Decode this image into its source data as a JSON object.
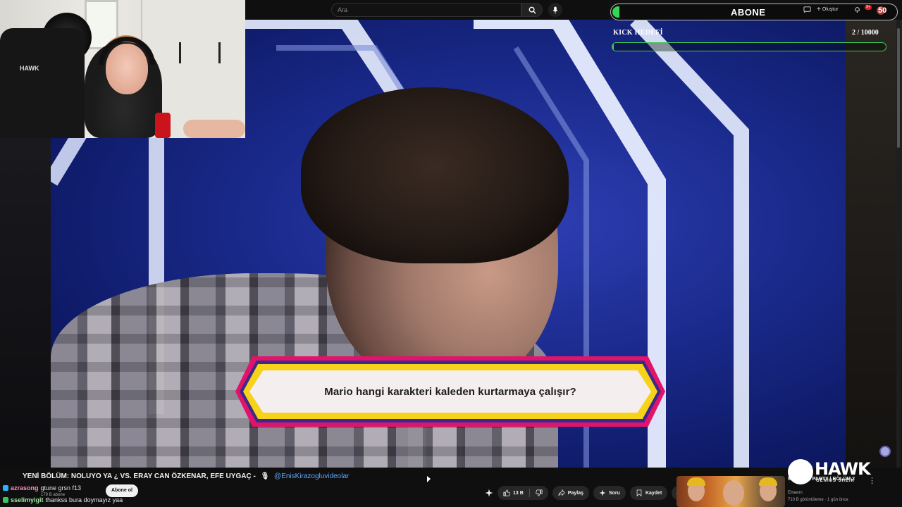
{
  "search": {
    "placeholder": "Ara"
  },
  "header": {
    "create_label": "Oluştur",
    "notifications_badge": "9+"
  },
  "overlay": {
    "abone_label": "ABONE",
    "abone_count": "50",
    "kick_goal_label": "KICK HEDEFİ",
    "kick_goal_count": "2 / 10000",
    "kick_goal_progress": 0.0002,
    "accent_color": "#3ccb57"
  },
  "video": {
    "question": "Mario hangi karakteri kaleden kurtarmaya çalışır?"
  },
  "webcam": {
    "chair_logo": "HAWK"
  },
  "info": {
    "title": "YENİ BÖLÜM: NOLUYO YA ¿ VS. ERAY CAN ÖZKENAR, EFE UYGAÇ -",
    "mention": "@EnisKirazogluvideolar",
    "subscribers": "179 B abone",
    "subscribe_label": "Abone ol"
  },
  "chat": [
    {
      "user": "azrasong",
      "message": "gtune grsn f13"
    },
    {
      "user": "sselimyigit",
      "message": "thankss bura doymayız yaa"
    }
  ],
  "actions": {
    "likes": "13 B",
    "share": "Paylaş",
    "ask": "Soru",
    "save": "Kaydet",
    "more": "···"
  },
  "recommendation": {
    "title": "MACHINE PARTY | BÖLÜM 2",
    "channel": "Elraenn",
    "meta": "710 B görüntüleme · 1 gün önce"
  },
  "brand": {
    "name": "HAWK",
    "tagline": "GENIUS SHEIK"
  }
}
